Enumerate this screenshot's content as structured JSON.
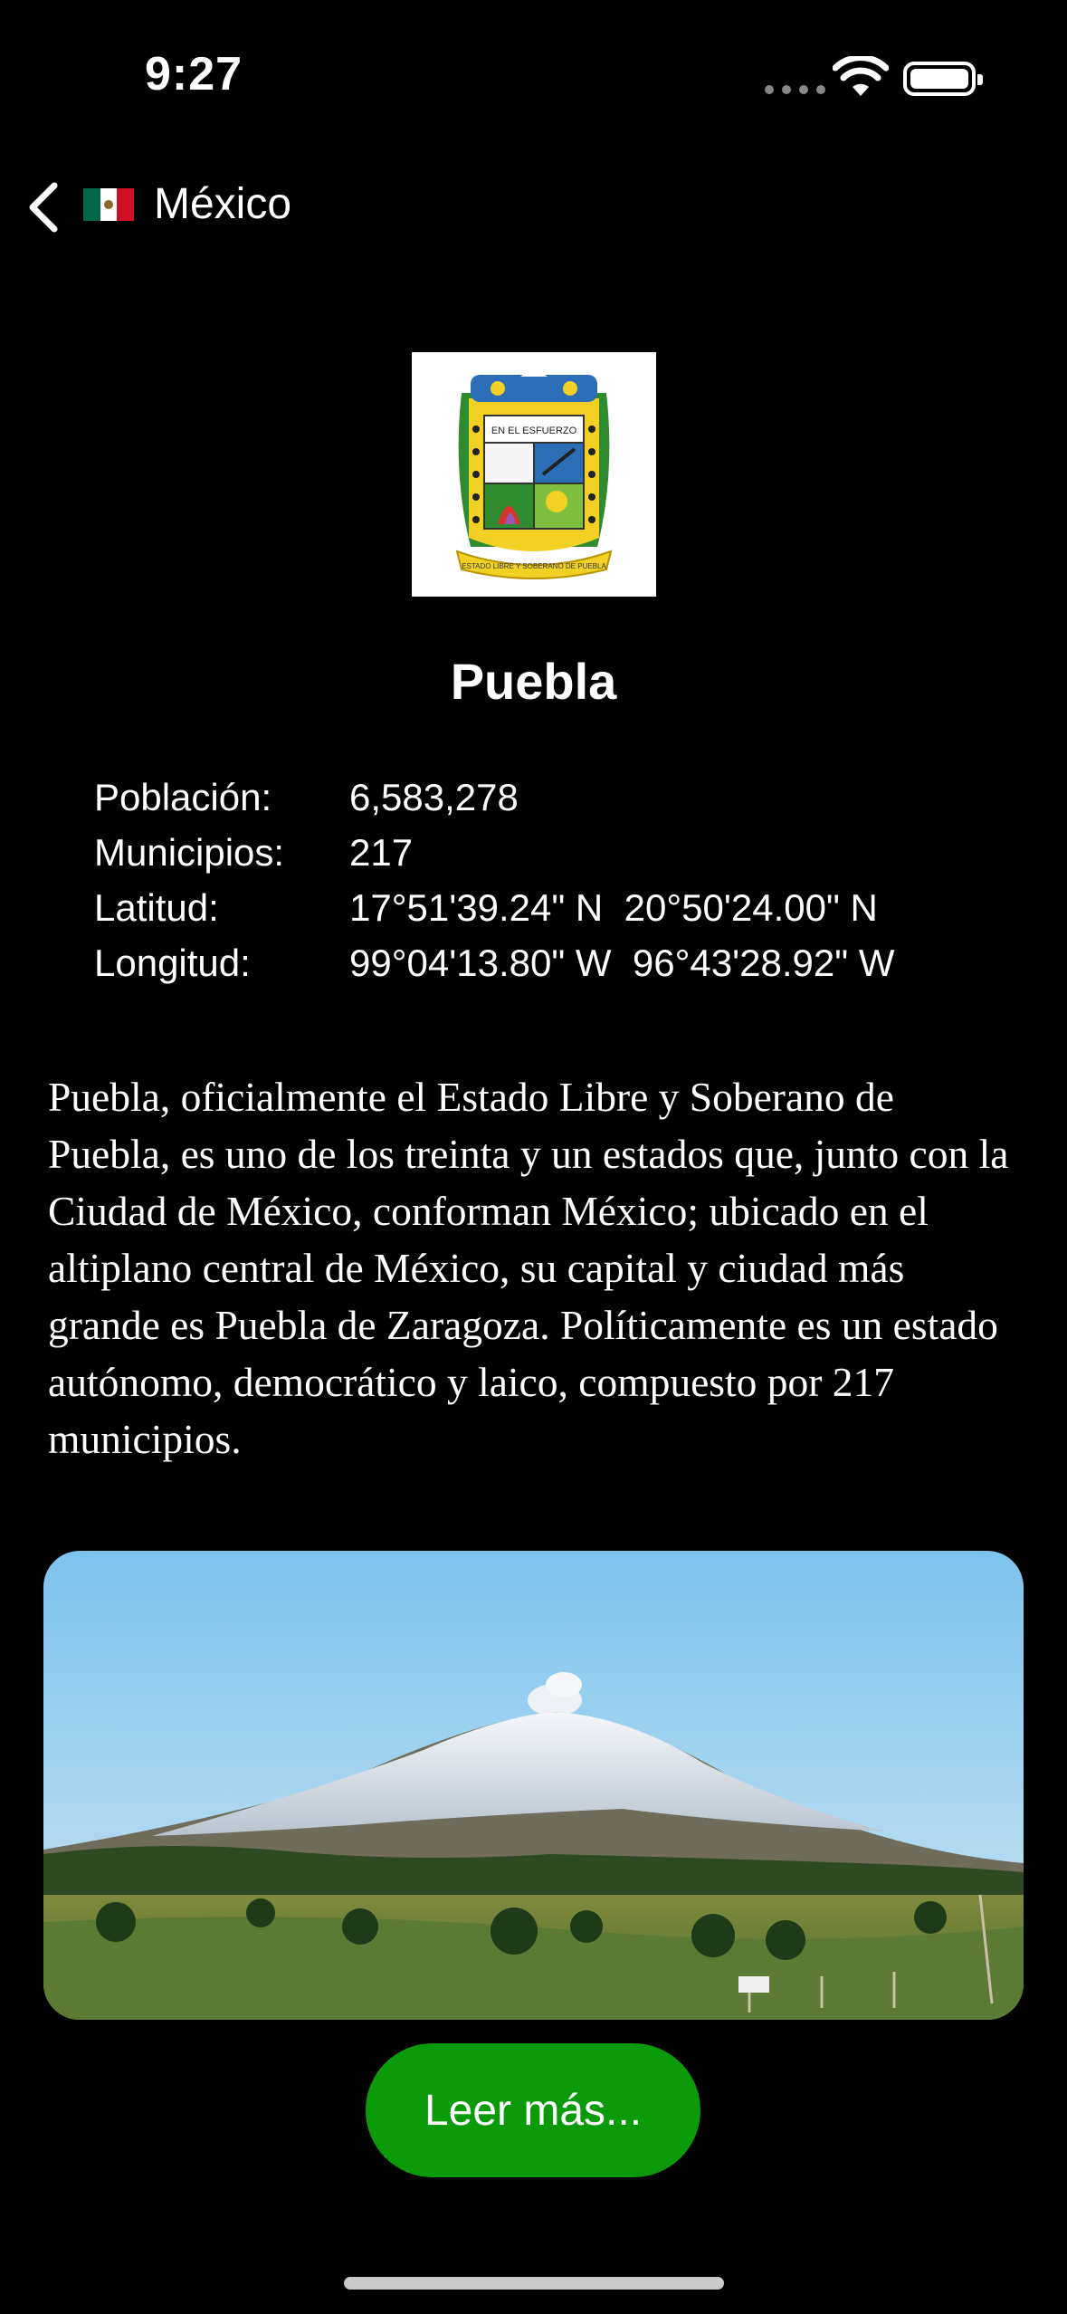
{
  "status_bar": {
    "time": "9:27"
  },
  "nav": {
    "back_label": "México",
    "flag_colors": [
      "#006847",
      "#ffffff",
      "#ce1126"
    ]
  },
  "state": {
    "name": "Puebla",
    "info": [
      {
        "label": "Población:",
        "value": "6,583,278"
      },
      {
        "label": "Municipios:",
        "value": "217"
      },
      {
        "label": "Latitud:",
        "value": "17°51'39.24\" N  20°50'24.00\" N"
      },
      {
        "label": "Longitud:",
        "value": "99°04'13.80\" W  96°43'28.92\" W"
      }
    ],
    "description": "Puebla, oficialmente el Estado Libre y Soberano de Puebla, es uno de los treinta y un estados que, junto con la Ciudad de México, conforman México; ubicado en el altiplano central de México, su capital y ciudad más grande es Puebla de Zaragoza. Políticamente es un estado autónomo, democrático y laico, compuesto por 217 municipios.",
    "read_more_label": "Leer más...",
    "emblem_motto": "EN EL ESFUERZO",
    "emblem_banner": "ESTADO LIBRE Y SOBERANO DE PUEBLA"
  },
  "colors": {
    "accent_button": "#0a9a0a",
    "background": "#000000"
  }
}
